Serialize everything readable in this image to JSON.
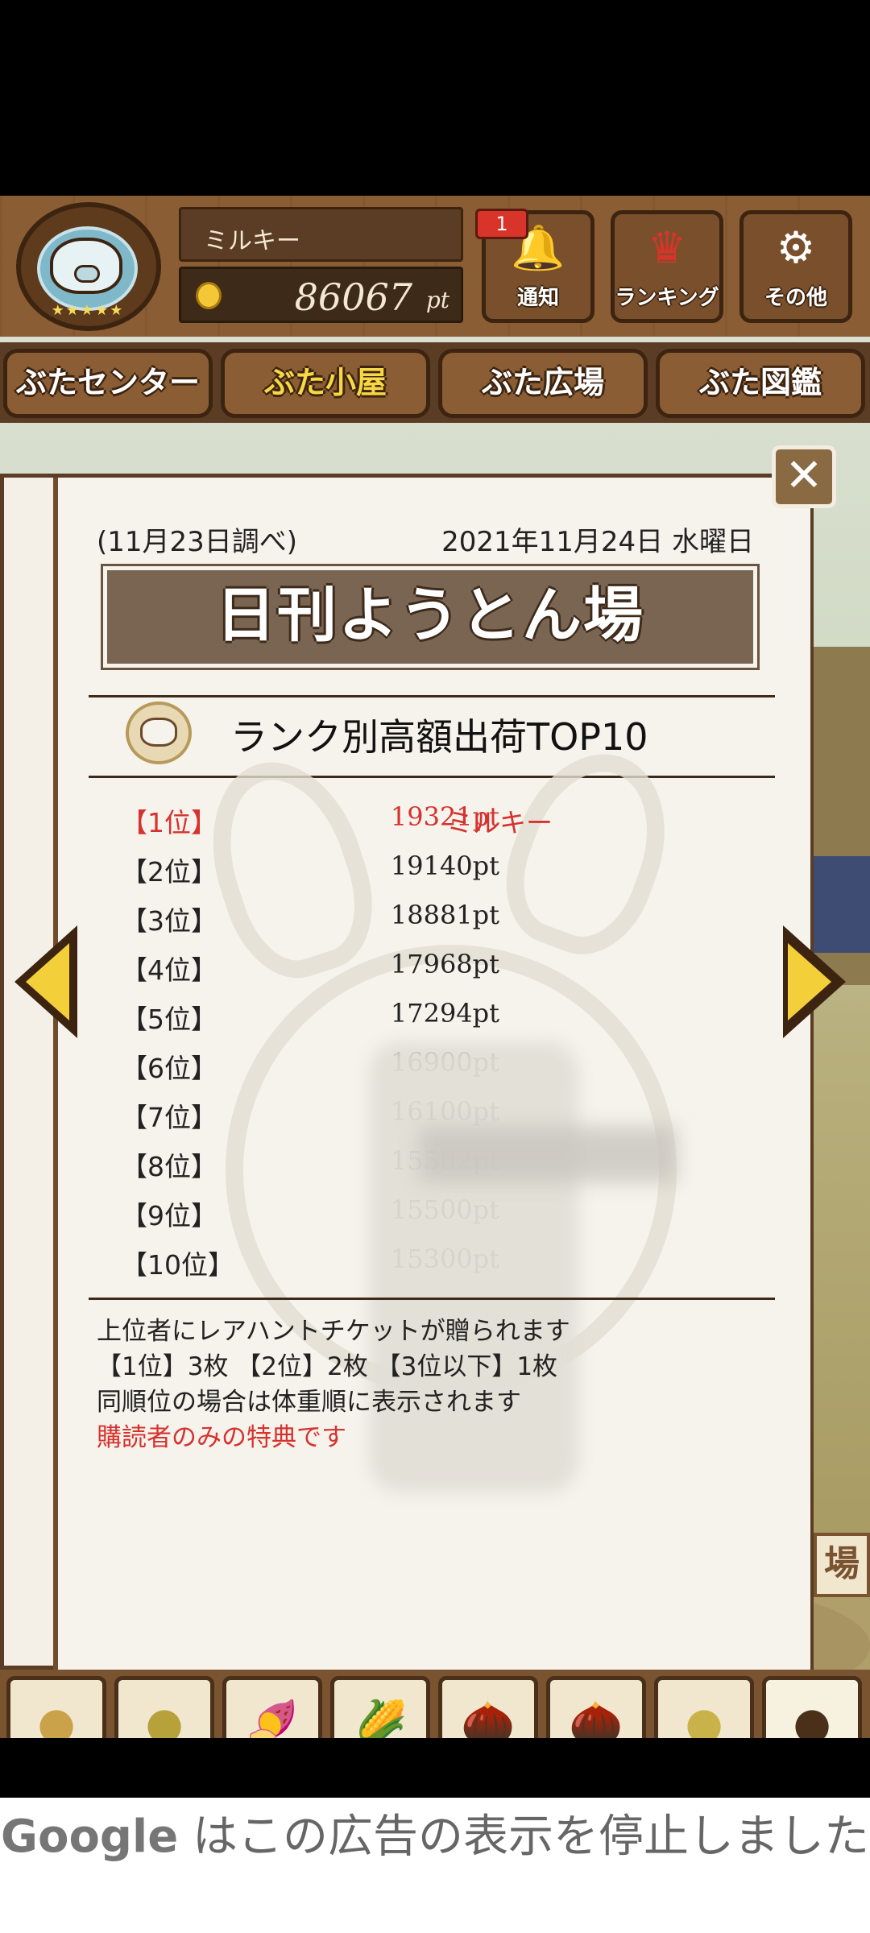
{
  "header": {
    "player_name": "ミルキー",
    "points_value": "86067",
    "points_unit": "pt",
    "notification_count": "1",
    "buttons": [
      {
        "label": "通知",
        "icon": "bell-icon"
      },
      {
        "label": "ランキング",
        "icon": "crown-icon"
      },
      {
        "label": "その他",
        "icon": "gear-icon"
      }
    ]
  },
  "tabs": [
    {
      "label": "ぶたセンター",
      "active": false
    },
    {
      "label": "ぶた小屋",
      "active": true
    },
    {
      "label": "ぶた広場",
      "active": false
    },
    {
      "label": "ぶた図鑑",
      "active": false
    }
  ],
  "dialog": {
    "survey_date": "(11月23日調べ)",
    "issue_date": "2021年11月24日 水曜日",
    "banner_title": "日刊ようとん場",
    "section_title": "ランク別高額出荷TOP10",
    "close_label": "✕",
    "rankings": [
      {
        "rank": "【1位】",
        "points": "19321pt",
        "name": "ミルキー"
      },
      {
        "rank": "【2位】",
        "points": "19140pt",
        "name": ""
      },
      {
        "rank": "【3位】",
        "points": "18881pt",
        "name": ""
      },
      {
        "rank": "【4位】",
        "points": "17968pt",
        "name": ""
      },
      {
        "rank": "【5位】",
        "points": "17294pt",
        "name": ""
      },
      {
        "rank": "【6位】",
        "points": "16900pt",
        "name": ""
      },
      {
        "rank": "【7位】",
        "points": "16100pt",
        "name": ""
      },
      {
        "rank": "【8位】",
        "points": "15502pt",
        "name": ""
      },
      {
        "rank": "【9位】",
        "points": "15500pt",
        "name": ""
      },
      {
        "rank": "【10位】",
        "points": "15300pt",
        "name": ""
      }
    ],
    "notes": [
      "上位者にレアハントチケットが贈られます",
      "【1位】3枚 【2位】2枚 【3位以下】1枚",
      "同順位の場合は体重順に表示されます"
    ],
    "subscriber_note": "購読者のみの特典です"
  },
  "items": [
    {
      "icon": "grain-pile-icon",
      "glyph": "●"
    },
    {
      "icon": "bean-pile-icon",
      "glyph": "●"
    },
    {
      "icon": "sweet-potato-icon",
      "glyph": "🍠"
    },
    {
      "icon": "corn-icon",
      "glyph": "🌽"
    },
    {
      "icon": "nuts-leaves-icon",
      "glyph": "🌰"
    },
    {
      "icon": "acorn-icon",
      "glyph": "🌰"
    },
    {
      "icon": "grain-plate-icon",
      "glyph": "●"
    },
    {
      "icon": "dark-food-plate-icon",
      "glyph": "●"
    }
  ],
  "scene_sign": "場",
  "ad": {
    "logo": "Google",
    "message": " はこの広告の表示を停止しました"
  },
  "colors": {
    "highlight_red": "#d6322e",
    "active_tab": "#f6d744",
    "wood": "#8a5d34"
  }
}
